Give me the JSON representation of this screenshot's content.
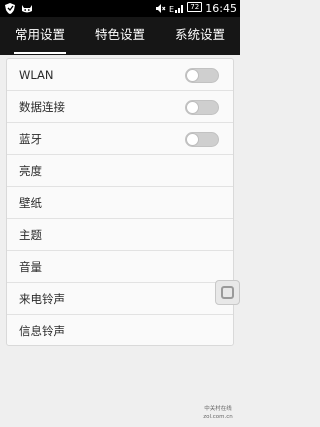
{
  "status_bar": {
    "battery": "72",
    "time": "16:45",
    "icons": [
      "shield-icon",
      "cat-icon",
      "mute-icon",
      "signal-icon",
      "battery-icon"
    ]
  },
  "tabs": [
    {
      "label": "常用设置",
      "active": true
    },
    {
      "label": "特色设置",
      "active": false
    },
    {
      "label": "系统设置",
      "active": false
    }
  ],
  "settings": {
    "rows": [
      {
        "label": "WLAN",
        "toggle": false
      },
      {
        "label": "数据连接",
        "toggle": false
      },
      {
        "label": "蓝牙",
        "toggle": false
      },
      {
        "label": "亮度"
      },
      {
        "label": "壁纸"
      },
      {
        "label": "主题"
      },
      {
        "label": "音量"
      },
      {
        "label": "来电铃声"
      },
      {
        "label": "信息铃声"
      }
    ]
  },
  "watermark": {
    "text": "中关村在线 zol.com.cn"
  },
  "colors": {
    "header_bg": "#161616",
    "page_bg": "#efefef",
    "toggle_off": "#cfcfcf"
  }
}
